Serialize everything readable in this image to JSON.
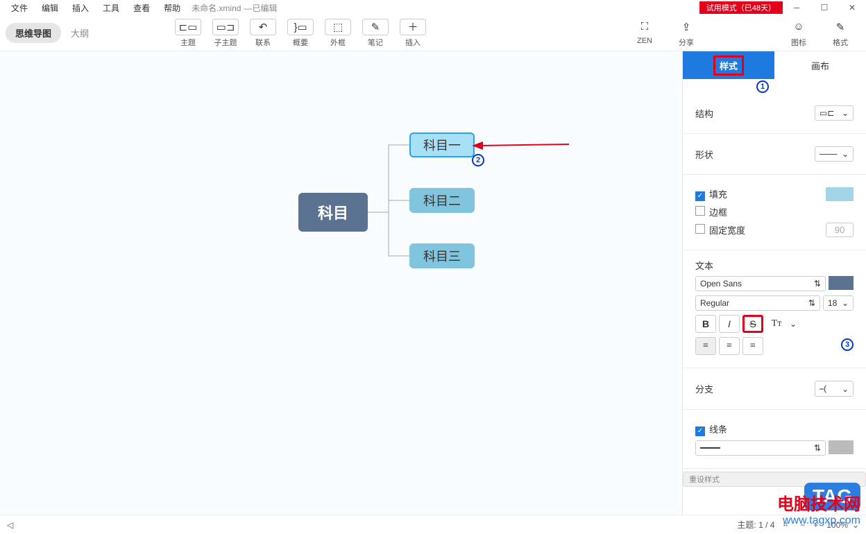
{
  "menu": {
    "file": "文件",
    "edit": "编辑",
    "insert": "插入",
    "tools": "工具",
    "view": "查看",
    "help": "帮助"
  },
  "filename": "未命名.xmind",
  "editstate": "—已编辑",
  "trial": "试用模式（已48天）",
  "tabs": {
    "mindmap": "思维导图",
    "outline": "大纲"
  },
  "tools": {
    "topic": "主题",
    "subtopic": "子主题",
    "relation": "联系",
    "summary": "概要",
    "boundary": "外框",
    "note": "笔记",
    "insert": "插入"
  },
  "toolsR": {
    "zen": "ZEN",
    "share": "分享",
    "emoji": "图标",
    "format": "格式"
  },
  "nodes": {
    "main": "科目",
    "s1": "科目一",
    "s2": "科目二",
    "s3": "科目三"
  },
  "side": {
    "tabStyle": "样式",
    "tabCanvas": "画布",
    "structure": "结构",
    "shape": "形状",
    "fill": "填充",
    "border": "边框",
    "fixedWidth": "固定宽度",
    "fixedWidthVal": "90",
    "text": "文本",
    "font": "Open Sans",
    "weight": "Regular",
    "size": "18",
    "branch": "分支",
    "line": "线条",
    "reset": "重设样式"
  },
  "status": {
    "topic": "主题: 1 / 4",
    "zoom": "100%"
  },
  "watermark": {
    "l1": "电脑技术网",
    "l2": "www.tagxp.com",
    "tag": "TAG"
  },
  "nums": {
    "n1": "1",
    "n2": "2",
    "n3": "3"
  }
}
